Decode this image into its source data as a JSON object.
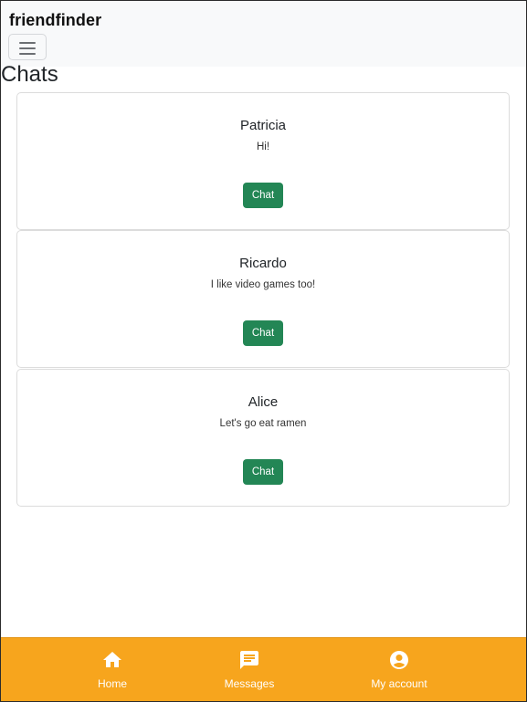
{
  "navbar": {
    "brand": "friendfinder",
    "toggler_icon": "hamburger-icon"
  },
  "page": {
    "title": "Chats"
  },
  "chats": [
    {
      "name": "Patricia",
      "message": "Hi!",
      "button_label": "Chat"
    },
    {
      "name": "Ricardo",
      "message": "I like video games too!",
      "button_label": "Chat"
    },
    {
      "name": "Alice",
      "message": "Let's go eat ramen",
      "button_label": "Chat"
    }
  ],
  "bottom_nav": {
    "items": [
      {
        "label": "Home",
        "icon": "home-icon"
      },
      {
        "label": "Messages",
        "icon": "message-icon"
      },
      {
        "label": "My account",
        "icon": "account-circle-icon"
      }
    ]
  },
  "colors": {
    "navbar_bg": "#f8f9fa",
    "chat_button": "#238655",
    "bottom_nav_bg": "#f7a51d",
    "bottom_nav_text": "#ffffff"
  }
}
